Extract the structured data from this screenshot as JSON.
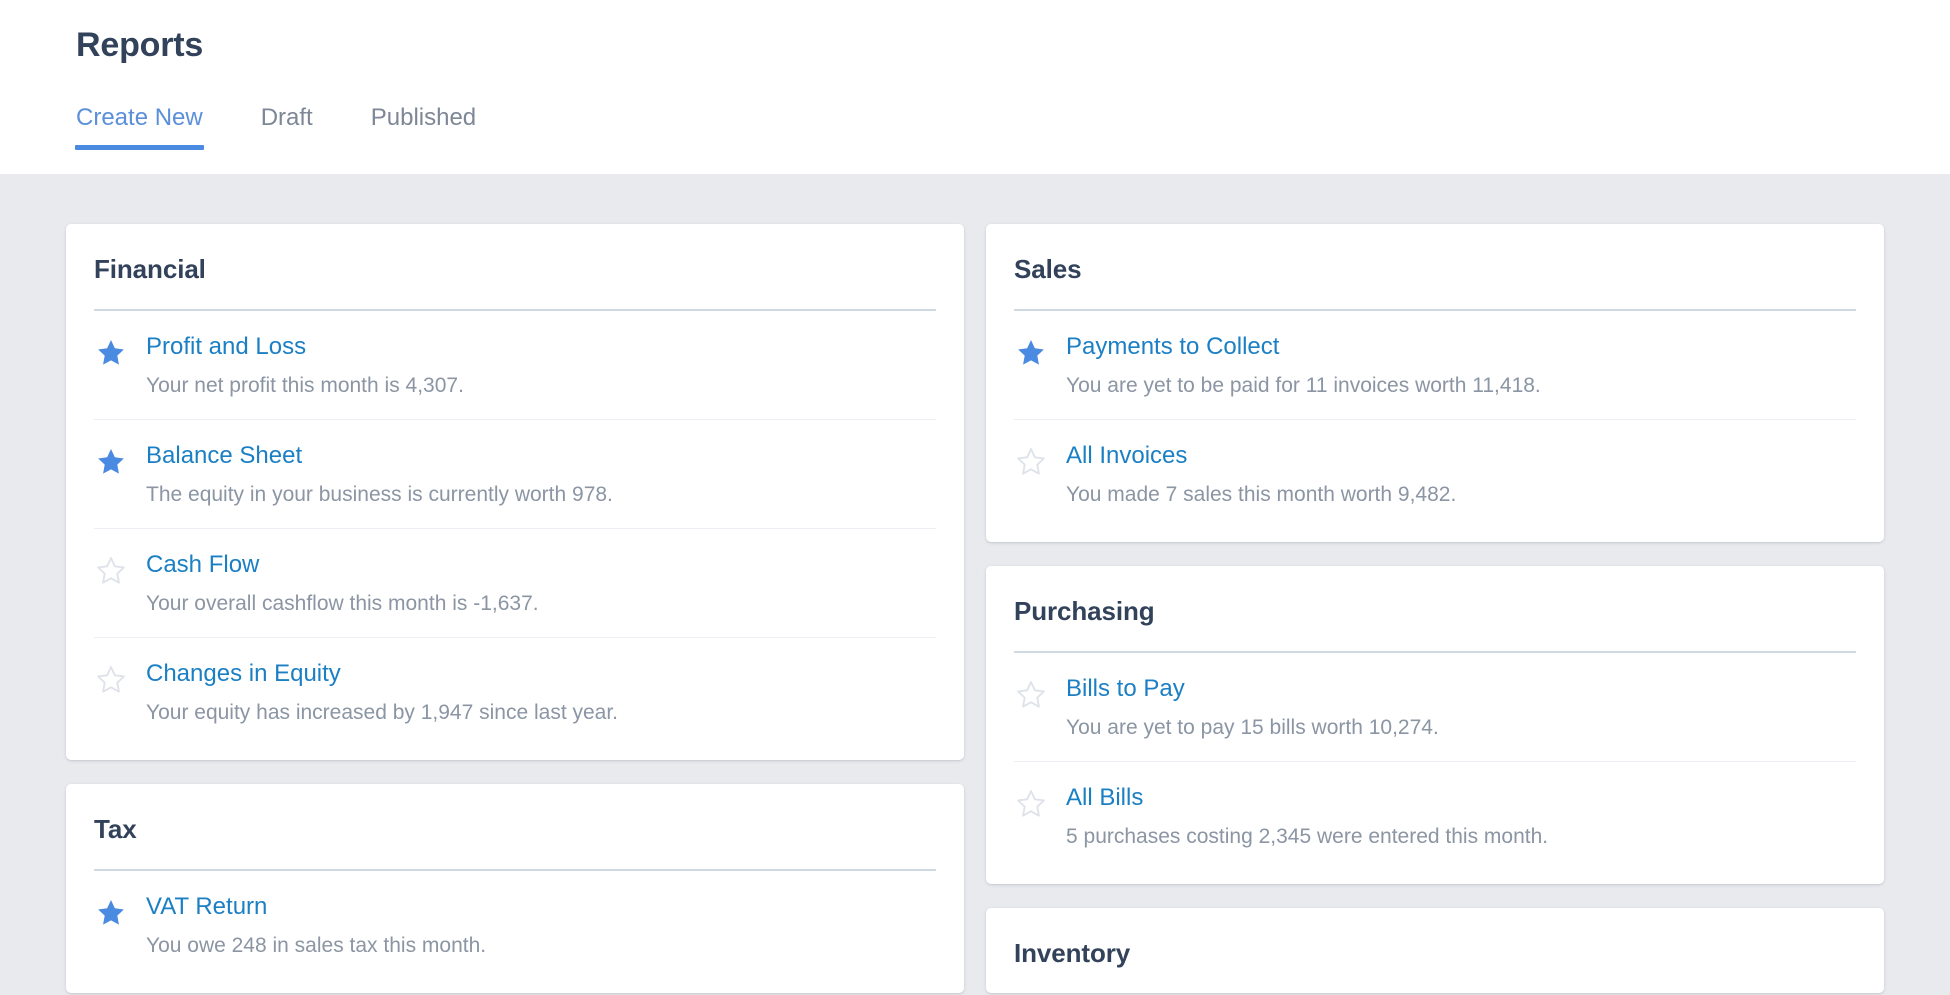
{
  "header": {
    "title": "Reports",
    "tabs": [
      {
        "label": "Create New",
        "active": true
      },
      {
        "label": "Draft",
        "active": false
      },
      {
        "label": "Published",
        "active": false
      }
    ]
  },
  "colors": {
    "accent_blue": "#4a8ae0",
    "link_blue": "#1b7fc4",
    "active_tab_text": "#5b8fd9",
    "star_filled": "#4a8ae0",
    "star_empty": "#dfe3e9",
    "heading_navy": "#32425a",
    "muted_text": "#8b95a3",
    "page_background": "#e8eaee",
    "card_background": "#ffffff"
  },
  "columns": [
    {
      "name": "left",
      "cards": [
        {
          "title": "Financial",
          "rows": [
            {
              "starred": true,
              "star_icon": "star-filled-icon",
              "link": "Profit and Loss",
              "description": "Your net profit this month is 4,307."
            },
            {
              "starred": true,
              "star_icon": "star-filled-icon",
              "link": "Balance Sheet",
              "description": "The equity in your business is currently worth 978."
            },
            {
              "starred": false,
              "star_icon": "star-outline-icon",
              "link": "Cash Flow",
              "description": "Your overall cashflow this month is -1,637."
            },
            {
              "starred": false,
              "star_icon": "star-outline-icon",
              "link": "Changes in Equity",
              "description": "Your equity has increased by 1,947 since last year."
            }
          ]
        },
        {
          "title": "Tax",
          "rows": [
            {
              "starred": true,
              "star_icon": "star-filled-icon",
              "link": "VAT Return",
              "description": "You owe 248 in sales tax this month."
            }
          ]
        }
      ]
    },
    {
      "name": "right",
      "cards": [
        {
          "title": "Sales",
          "rows": [
            {
              "starred": true,
              "star_icon": "star-filled-icon",
              "link": "Payments to Collect",
              "description": "You are yet to be paid for 11 invoices worth 11,418."
            },
            {
              "starred": false,
              "star_icon": "star-outline-icon",
              "link": "All Invoices",
              "description": "You made 7 sales this month worth 9,482."
            }
          ]
        },
        {
          "title": "Purchasing",
          "rows": [
            {
              "starred": false,
              "star_icon": "star-outline-icon",
              "link": "Bills to Pay",
              "description": "You are yet to pay 15 bills worth 10,274."
            },
            {
              "starred": false,
              "star_icon": "star-outline-icon",
              "link": "All Bills",
              "description": "5 purchases costing 2,345 were entered this month."
            }
          ]
        },
        {
          "title": "Inventory",
          "partial": true,
          "rows": []
        }
      ]
    }
  ]
}
